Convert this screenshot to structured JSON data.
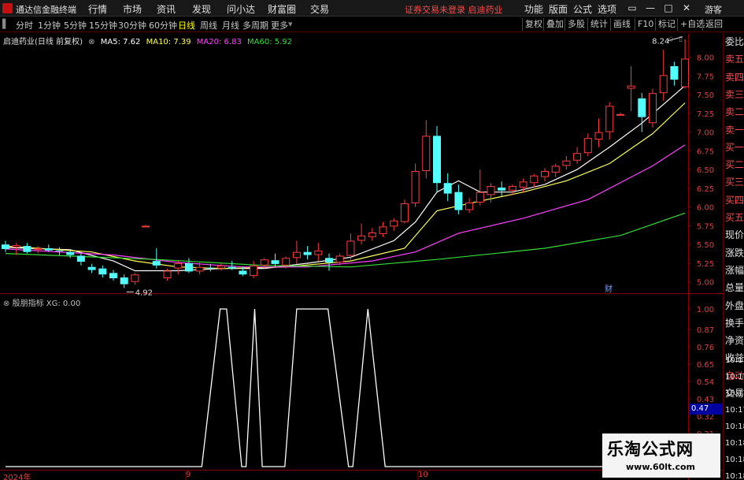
{
  "titlebar": {
    "app_name": "通达信金融终端",
    "menus": [
      "行情",
      "市场",
      "资讯",
      "发现",
      "问小达",
      "财富圈",
      "交易"
    ],
    "notice": "证券交易未登录  启迪药业",
    "right_menus": [
      "功能",
      "版面",
      "公式",
      "选项"
    ],
    "guest": "游客",
    "colors": {
      "bg": "#181818",
      "logo": "#c41010",
      "notice": "#ff4848"
    }
  },
  "toolbar": {
    "periods": [
      "分时",
      "1分钟",
      "5分钟",
      "15分钟",
      "30分钟",
      "60分钟",
      "日线",
      "周线",
      "月线",
      "多周期",
      "更多"
    ],
    "active_period": "日线",
    "right_buttons": [
      "复权",
      "叠加",
      "多股",
      "统计",
      "画线",
      "F10",
      "标记",
      "+自选",
      "返回"
    ]
  },
  "legend": {
    "title": "启迪药业(日线 前复权)",
    "ma": [
      {
        "label": "MA5: 7.62",
        "color": "#ffffff"
      },
      {
        "label": "MA10: 7.39",
        "color": "#ffff55"
      },
      {
        "label": "MA20: 6.83",
        "color": "#ff40ff"
      },
      {
        "label": "MA60: 5.92",
        "color": "#33dd33"
      }
    ]
  },
  "indicator_legend": {
    "name": "殷朋指标",
    "value": "XG: 0.00"
  },
  "right_panel": {
    "items": [
      {
        "label": "委比",
        "red": false
      },
      {
        "label": "卖五",
        "red": true
      },
      {
        "label": "卖四",
        "red": true
      },
      {
        "label": "卖三",
        "red": true
      },
      {
        "label": "卖二",
        "red": true
      },
      {
        "label": "卖一",
        "red": true
      },
      {
        "label": "买一",
        "red": true
      },
      {
        "label": "买二",
        "red": true
      },
      {
        "label": "买三",
        "red": true
      },
      {
        "label": "买四",
        "red": true
      },
      {
        "label": "买五",
        "red": true
      },
      {
        "label": "现价",
        "red": false
      },
      {
        "label": "涨跌",
        "red": false
      },
      {
        "label": "涨幅",
        "red": false
      },
      {
        "label": "总量",
        "red": false
      },
      {
        "label": "外盘",
        "red": false
      },
      {
        "label": "换手",
        "red": false
      },
      {
        "label": "净资",
        "red": false
      },
      {
        "label": "收益",
        "red": false
      },
      {
        "label": "自动",
        "red": true
      },
      {
        "label": "交易",
        "red": false
      }
    ],
    "times": [
      "10:17",
      "10:17",
      "10:17",
      "10:17",
      "10:18",
      "10:18",
      "10:18",
      "10:18",
      "10:18"
    ]
  },
  "indicator_value_box": "0.47",
  "cai_badge": "财",
  "watermark": {
    "title": "乐淘公式网",
    "url": "www.60lt.com"
  },
  "chart_data": [
    {
      "type": "candlestick",
      "title": "启迪药业(日线 前复权)",
      "price_axis": {
        "ylim": [
          4.85,
          8.3
        ],
        "ticks": [
          5.0,
          5.25,
          5.5,
          5.75,
          6.0,
          6.25,
          6.5,
          6.75,
          7.0,
          7.25,
          7.5,
          7.75,
          8.0
        ]
      },
      "x_labels": [
        "2024年",
        "9",
        "10"
      ],
      "annotations": {
        "high_label": "8.24",
        "low_label": "4.92"
      },
      "candles": [
        {
          "o": 5.5,
          "h": 5.55,
          "l": 5.4,
          "c": 5.44
        },
        {
          "o": 5.46,
          "h": 5.52,
          "l": 5.36,
          "c": 5.49
        },
        {
          "o": 5.48,
          "h": 5.52,
          "l": 5.38,
          "c": 5.4
        },
        {
          "o": 5.44,
          "h": 5.48,
          "l": 5.38,
          "c": 5.45
        },
        {
          "o": 5.45,
          "h": 5.5,
          "l": 5.4,
          "c": 5.42
        },
        {
          "o": 5.42,
          "h": 5.46,
          "l": 5.36,
          "c": 5.41
        },
        {
          "o": 5.4,
          "h": 5.42,
          "l": 5.32,
          "c": 5.36
        },
        {
          "o": 5.35,
          "h": 5.38,
          "l": 5.22,
          "c": 5.27
        },
        {
          "o": 5.2,
          "h": 5.24,
          "l": 5.12,
          "c": 5.16
        },
        {
          "o": 5.18,
          "h": 5.22,
          "l": 5.06,
          "c": 5.1
        },
        {
          "o": 5.12,
          "h": 5.16,
          "l": 5.02,
          "c": 5.05
        },
        {
          "o": 5.06,
          "h": 5.1,
          "l": 4.92,
          "c": 4.97
        },
        {
          "o": 5.0,
          "h": 5.12,
          "l": 4.96,
          "c": 5.1
        },
        {
          "o": 5.75,
          "h": 5.76,
          "l": 5.74,
          "c": 5.75
        },
        {
          "o": 5.28,
          "h": 5.45,
          "l": 5.18,
          "c": 5.22
        },
        {
          "o": 5.05,
          "h": 5.18,
          "l": 5.02,
          "c": 5.15
        },
        {
          "o": 5.18,
          "h": 5.28,
          "l": 5.1,
          "c": 5.25
        },
        {
          "o": 5.25,
          "h": 5.32,
          "l": 5.12,
          "c": 5.14
        },
        {
          "o": 5.14,
          "h": 5.26,
          "l": 5.1,
          "c": 5.2
        },
        {
          "o": 5.19,
          "h": 5.24,
          "l": 5.14,
          "c": 5.18
        },
        {
          "o": 5.18,
          "h": 5.25,
          "l": 5.15,
          "c": 5.22
        },
        {
          "o": 5.2,
          "h": 5.28,
          "l": 5.16,
          "c": 5.18
        },
        {
          "o": 5.15,
          "h": 5.2,
          "l": 5.08,
          "c": 5.1
        },
        {
          "o": 5.08,
          "h": 5.28,
          "l": 5.05,
          "c": 5.22
        },
        {
          "o": 5.22,
          "h": 5.32,
          "l": 5.18,
          "c": 5.3
        },
        {
          "o": 5.29,
          "h": 5.38,
          "l": 5.2,
          "c": 5.24
        },
        {
          "o": 5.22,
          "h": 5.34,
          "l": 5.18,
          "c": 5.32
        },
        {
          "o": 5.32,
          "h": 5.55,
          "l": 5.24,
          "c": 5.4
        },
        {
          "o": 5.4,
          "h": 5.48,
          "l": 5.3,
          "c": 5.36
        },
        {
          "o": 5.36,
          "h": 5.52,
          "l": 5.28,
          "c": 5.42
        },
        {
          "o": 5.32,
          "h": 5.38,
          "l": 5.15,
          "c": 5.26
        },
        {
          "o": 5.26,
          "h": 5.38,
          "l": 5.22,
          "c": 5.35
        },
        {
          "o": 5.35,
          "h": 5.65,
          "l": 5.3,
          "c": 5.55
        },
        {
          "o": 5.55,
          "h": 5.78,
          "l": 5.5,
          "c": 5.62
        },
        {
          "o": 5.6,
          "h": 5.72,
          "l": 5.55,
          "c": 5.66
        },
        {
          "o": 5.64,
          "h": 5.8,
          "l": 5.6,
          "c": 5.74
        },
        {
          "o": 5.74,
          "h": 5.85,
          "l": 5.68,
          "c": 5.82
        },
        {
          "o": 5.8,
          "h": 6.1,
          "l": 5.78,
          "c": 6.05
        },
        {
          "o": 6.05,
          "h": 6.58,
          "l": 6.0,
          "c": 6.48
        },
        {
          "o": 6.48,
          "h": 7.16,
          "l": 6.38,
          "c": 6.95
        },
        {
          "o": 6.95,
          "h": 7.08,
          "l": 6.2,
          "c": 6.32
        },
        {
          "o": 6.32,
          "h": 6.45,
          "l": 6.08,
          "c": 6.18
        },
        {
          "o": 6.2,
          "h": 6.3,
          "l": 5.9,
          "c": 5.96
        },
        {
          "o": 5.96,
          "h": 6.12,
          "l": 5.92,
          "c": 6.06
        },
        {
          "o": 6.06,
          "h": 6.5,
          "l": 6.02,
          "c": 6.2
        },
        {
          "o": 6.16,
          "h": 6.32,
          "l": 6.06,
          "c": 6.28
        },
        {
          "o": 6.26,
          "h": 6.34,
          "l": 6.14,
          "c": 6.22
        },
        {
          "o": 6.22,
          "h": 6.3,
          "l": 6.16,
          "c": 6.28
        },
        {
          "o": 6.26,
          "h": 6.38,
          "l": 6.2,
          "c": 6.34
        },
        {
          "o": 6.32,
          "h": 6.44,
          "l": 6.26,
          "c": 6.42
        },
        {
          "o": 6.4,
          "h": 6.52,
          "l": 6.34,
          "c": 6.48
        },
        {
          "o": 6.46,
          "h": 6.58,
          "l": 6.4,
          "c": 6.55
        },
        {
          "o": 6.55,
          "h": 6.68,
          "l": 6.5,
          "c": 6.62
        },
        {
          "o": 6.62,
          "h": 6.8,
          "l": 6.58,
          "c": 6.72
        },
        {
          "o": 6.72,
          "h": 6.98,
          "l": 6.68,
          "c": 6.92
        },
        {
          "o": 6.9,
          "h": 7.18,
          "l": 6.8,
          "c": 7.0
        },
        {
          "o": 7.0,
          "h": 7.4,
          "l": 6.9,
          "c": 7.35
        },
        {
          "o": 7.24,
          "h": 7.26,
          "l": 7.22,
          "c": 7.24
        },
        {
          "o": 7.58,
          "h": 7.88,
          "l": 7.28,
          "c": 7.62
        },
        {
          "o": 7.45,
          "h": 7.52,
          "l": 7.0,
          "c": 7.2
        },
        {
          "o": 7.12,
          "h": 7.58,
          "l": 7.06,
          "c": 7.52
        },
        {
          "o": 7.52,
          "h": 8.1,
          "l": 7.42,
          "c": 7.76
        },
        {
          "o": 7.88,
          "h": 7.94,
          "l": 7.62,
          "c": 7.7
        },
        {
          "o": 7.6,
          "h": 8.24,
          "l": 7.58,
          "c": 7.98
        }
      ],
      "ma": [
        {
          "name": "MA5",
          "color": "#ffffff",
          "points": [
            [
              0,
              5.46
            ],
            [
              6,
              5.43
            ],
            [
              10,
              5.28
            ],
            [
              12,
              5.15
            ],
            [
              16,
              5.15
            ],
            [
              20,
              5.18
            ],
            [
              24,
              5.18
            ],
            [
              28,
              5.25
            ],
            [
              32,
              5.33
            ],
            [
              36,
              5.55
            ],
            [
              38,
              5.8
            ],
            [
              40,
              6.2
            ],
            [
              42,
              6.35
            ],
            [
              44,
              6.2
            ],
            [
              47,
              6.2
            ],
            [
              50,
              6.3
            ],
            [
              53,
              6.5
            ],
            [
              56,
              6.8
            ],
            [
              59,
              7.12
            ],
            [
              63,
              7.62
            ]
          ]
        },
        {
          "name": "MA10",
          "color": "#ffff55",
          "points": [
            [
              0,
              5.48
            ],
            [
              8,
              5.4
            ],
            [
              12,
              5.28
            ],
            [
              16,
              5.2
            ],
            [
              20,
              5.18
            ],
            [
              26,
              5.2
            ],
            [
              32,
              5.28
            ],
            [
              37,
              5.45
            ],
            [
              40,
              5.95
            ],
            [
              44,
              6.08
            ],
            [
              48,
              6.2
            ],
            [
              52,
              6.35
            ],
            [
              56,
              6.58
            ],
            [
              60,
              6.98
            ],
            [
              63,
              7.39
            ]
          ]
        },
        {
          "name": "MA20",
          "color": "#ff40ff",
          "points": [
            [
              0,
              5.44
            ],
            [
              10,
              5.36
            ],
            [
              16,
              5.26
            ],
            [
              22,
              5.2
            ],
            [
              28,
              5.2
            ],
            [
              34,
              5.28
            ],
            [
              38,
              5.4
            ],
            [
              42,
              5.65
            ],
            [
              48,
              5.85
            ],
            [
              54,
              6.1
            ],
            [
              60,
              6.55
            ],
            [
              63,
              6.83
            ]
          ]
        },
        {
          "name": "MA60",
          "color": "#33dd33",
          "points": [
            [
              0,
              5.38
            ],
            [
              14,
              5.3
            ],
            [
              24,
              5.22
            ],
            [
              32,
              5.2
            ],
            [
              40,
              5.3
            ],
            [
              50,
              5.45
            ],
            [
              57,
              5.62
            ],
            [
              63,
              5.92
            ]
          ]
        }
      ]
    },
    {
      "type": "line",
      "title": "殷朋指标",
      "series": [
        {
          "name": "XG",
          "color": "#ffffff"
        }
      ],
      "ylim": [
        0,
        1
      ],
      "y_ticks": [
        0.1,
        0.21,
        0.32,
        0.43,
        0.54,
        0.65,
        0.76,
        0.87,
        1.0
      ],
      "points": [
        [
          0,
          0
        ],
        [
          18.2,
          0
        ],
        [
          19.9,
          1
        ],
        [
          20.5,
          1
        ],
        [
          21.9,
          0
        ],
        [
          22.3,
          0
        ],
        [
          23.1,
          1
        ],
        [
          23.8,
          0
        ],
        [
          25.9,
          0
        ],
        [
          27.0,
          1
        ],
        [
          29.9,
          1
        ],
        [
          31.8,
          0
        ],
        [
          32.2,
          0
        ],
        [
          33.6,
          1
        ],
        [
          35.2,
          0
        ],
        [
          63,
          0
        ]
      ]
    }
  ]
}
